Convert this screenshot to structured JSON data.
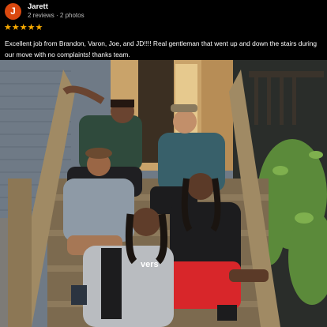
{
  "review": {
    "avatar_letter": "J",
    "author": "Jarett",
    "meta": "2 reviews · 2 photos",
    "rating": 5,
    "stars": "★★★★★",
    "text": "Excellent job from Brandon, Varon, Joe, and JD!!!! Real gentleman that went up and down the stairs during our move with no complaints! thanks team."
  },
  "photo": {
    "shirt_text": "vers"
  },
  "colors": {
    "avatar": "#d9480f",
    "star": "#f9ab00",
    "meta": "#bdbdbd"
  }
}
